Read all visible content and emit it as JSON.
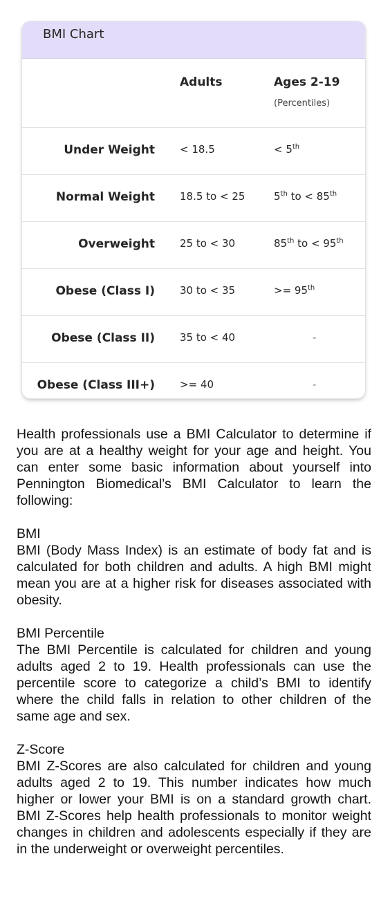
{
  "card": {
    "title": "BMI Chart",
    "columns": {
      "adults": "Adults",
      "ages": "Ages 2-19",
      "ages_sub": "(Percentiles)"
    },
    "rows": [
      {
        "label": "Under Weight",
        "adults": "< 18.5",
        "ages": {
          "pre": "< 5",
          "sup1": "th",
          "mid": "",
          "sup2": ""
        }
      },
      {
        "label": "Normal Weight",
        "adults": "18.5 to < 25",
        "ages": {
          "pre": "5",
          "sup1": "th",
          "mid": " to < 85",
          "sup2": "th"
        }
      },
      {
        "label": "Overweight",
        "adults": "25 to < 30",
        "ages": {
          "pre": "85",
          "sup1": "th",
          "mid": " to < 95",
          "sup2": "th"
        }
      },
      {
        "label": "Obese (Class I)",
        "adults": "30 to < 35",
        "ages": {
          "pre": ">= 95",
          "sup1": "th",
          "mid": "",
          "sup2": ""
        }
      },
      {
        "label": "Obese (Class II)",
        "adults": "35 to < 40",
        "ages_dash": "-"
      },
      {
        "label": "Obese (Class III+)",
        "adults": ">= 40",
        "ages_dash": "-"
      }
    ]
  },
  "article": {
    "intro": "Health professionals use a BMI Calculator to determine if you are at a healthy weight for your age and height. You can enter some basic information about yourself into Pennington Biomedical’s BMI Calculator to learn the following:",
    "sections": [
      {
        "heading": "BMI",
        "body": "BMI (Body Mass Index) is an estimate of body fat and is calculated for both children and adults. A high BMI might mean you are at a higher risk for diseases associated with obesity."
      },
      {
        "heading": "BMI Percentile",
        "body": "The BMI Percentile is calculated for children and young adults aged 2 to 19.  Health professionals can use the percentile score to categorize a child’s BMI to identify where the child falls in relation to other children of the same age and sex."
      },
      {
        "heading": "Z-Score",
        "body": "BMI Z-Scores are also calculated for children and young adults aged 2 to 19. This number indicates how much higher or lower your BMI is on a standard growth chart. BMI Z-Scores help health professionals to monitor weight changes in children and adolescents especially if they are in the underweight or overweight percentiles."
      }
    ]
  }
}
